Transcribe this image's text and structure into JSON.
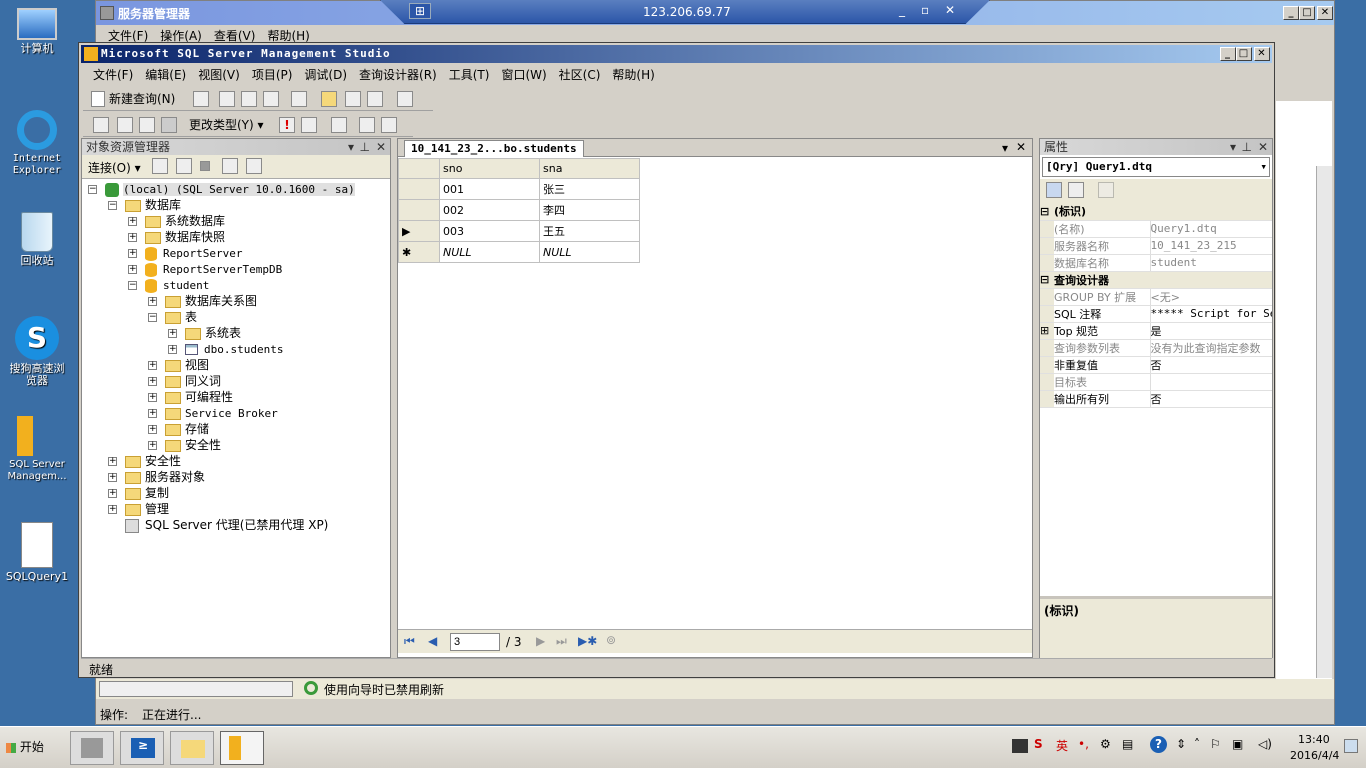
{
  "desktop_icons": [
    {
      "label": "计算机",
      "icon": "computer-icon"
    },
    {
      "label": "Internet Explorer",
      "icon": "ie-icon"
    },
    {
      "label": "回收站",
      "icon": "recycle-bin-icon"
    },
    {
      "label": "搜狗高速浏览器",
      "icon": "sogou-browser-icon"
    },
    {
      "label": "SQL Server Managem...",
      "icon": "ssms-shortcut-icon"
    },
    {
      "label": "SQLQuery1",
      "icon": "sql-file-icon"
    }
  ],
  "rdp": {
    "host": "123.206.69.77"
  },
  "server_manager": {
    "title": "服务器管理器",
    "menu": [
      "文件(F)",
      "操作(A)",
      "查看(V)",
      "帮助(H)"
    ],
    "refresh_text": "使用向导时已禁用刷新",
    "status_label": "操作:",
    "status_value": "正在进行..."
  },
  "ssms": {
    "title": "Microsoft SQL Server Management Studio",
    "menu": [
      "文件(F)",
      "编辑(E)",
      "视图(V)",
      "项目(P)",
      "调试(D)",
      "查询设计器(R)",
      "工具(T)",
      "窗口(W)",
      "社区(C)",
      "帮助(H)"
    ],
    "toolbar": {
      "new_query": "新建查询(N)",
      "change_type": "更改类型(Y)"
    },
    "status": "就绪"
  },
  "object_explorer": {
    "title": "对象资源管理器",
    "connect": "连接(O)",
    "nodes": [
      {
        "label": "(local) (SQL Server 10.0.1600 - sa)",
        "type": "server"
      },
      {
        "label": "数据库",
        "type": "folder"
      },
      {
        "label": "系统数据库",
        "type": "folder"
      },
      {
        "label": "数据库快照",
        "type": "folder"
      },
      {
        "label": "ReportServer",
        "type": "db"
      },
      {
        "label": "ReportServerTempDB",
        "type": "db"
      },
      {
        "label": "student",
        "type": "db"
      },
      {
        "label": "数据库关系图",
        "type": "folder"
      },
      {
        "label": "表",
        "type": "folder"
      },
      {
        "label": "系统表",
        "type": "folder"
      },
      {
        "label": "dbo.students",
        "type": "table"
      },
      {
        "label": "视图",
        "type": "folder"
      },
      {
        "label": "同义词",
        "type": "folder"
      },
      {
        "label": "可编程性",
        "type": "folder"
      },
      {
        "label": "Service Broker",
        "type": "folder"
      },
      {
        "label": "存储",
        "type": "folder"
      },
      {
        "label": "安全性",
        "type": "folder"
      },
      {
        "label": "安全性",
        "type": "folder"
      },
      {
        "label": "服务器对象",
        "type": "folder"
      },
      {
        "label": "复制",
        "type": "folder"
      },
      {
        "label": "管理",
        "type": "folder"
      },
      {
        "label": "SQL Server 代理(已禁用代理 XP)",
        "type": "agent"
      }
    ]
  },
  "doc_tab": {
    "label": "10_141_23_2...bo.students"
  },
  "grid": {
    "columns": [
      "sno",
      "sna"
    ],
    "rows": [
      [
        "001",
        "张三"
      ],
      [
        "002",
        "李四"
      ],
      [
        "003",
        "王五"
      ],
      [
        "NULL",
        "NULL"
      ]
    ],
    "nav": {
      "current": "3",
      "total": "/ 3"
    }
  },
  "properties": {
    "title": "属性",
    "object": "[Qry] Query1.dtq",
    "sections": [
      {
        "name": "(标识)",
        "rows": [
          [
            "(名称)",
            "Query1.dtq"
          ],
          [
            "服务器名称",
            "10_141_23_215"
          ],
          [
            "数据库名称",
            "student"
          ]
        ]
      },
      {
        "name": "查询设计器",
        "rows": [
          [
            "GROUP BY 扩展",
            "<无>"
          ],
          [
            "SQL 注释",
            "***** Script for Sel"
          ],
          [
            "Top 规范",
            "是"
          ],
          [
            "查询参数列表",
            "没有为此查询指定参数"
          ],
          [
            "非重复值",
            "否"
          ],
          [
            "目标表",
            ""
          ],
          [
            "输出所有列",
            "否"
          ]
        ]
      }
    ],
    "description_title": "(标识)"
  },
  "taskbar": {
    "start": "开始",
    "ime": "英",
    "time": "13:40",
    "date": "2016/4/4"
  }
}
